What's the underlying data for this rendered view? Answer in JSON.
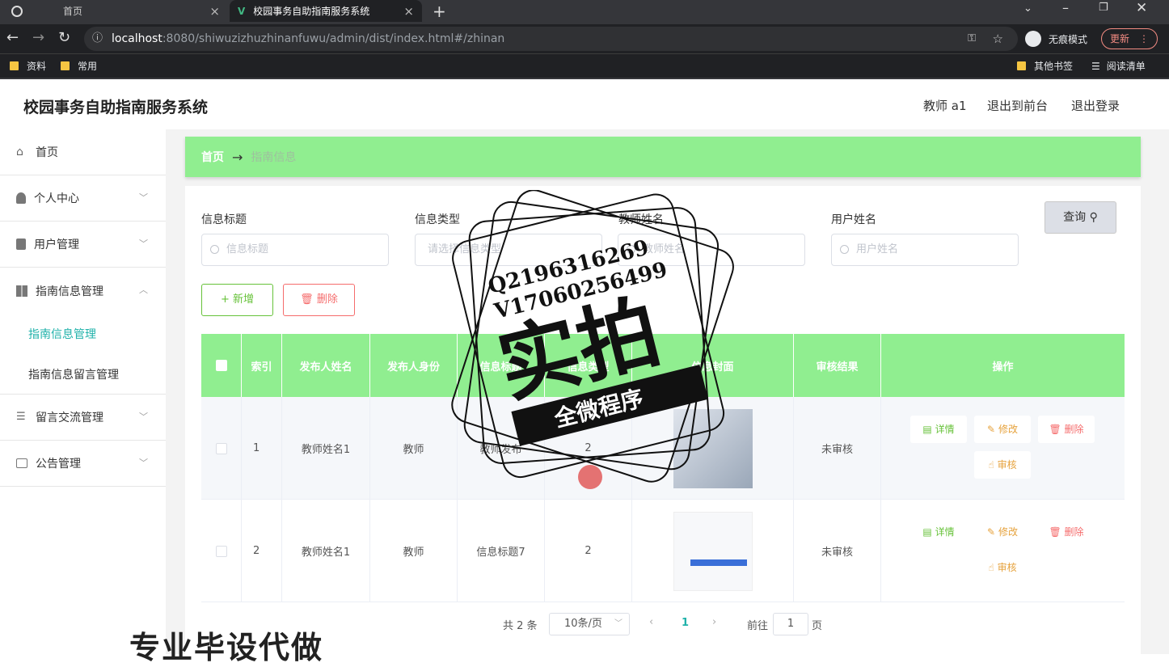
{
  "browser": {
    "tabs": [
      {
        "label": "首页"
      },
      {
        "label": "校园事务自助指南服务系统"
      }
    ],
    "url_host": "localhost",
    "url_rest": ":8080/shiwuzizhuzhinanfuwu/admin/dist/index.html#/zhinan",
    "incognito": "无痕模式",
    "update": "更新",
    "bookmarks": [
      "资料",
      "常用"
    ],
    "other_bookmarks": "其他书签",
    "reading_list": "阅读清单"
  },
  "header": {
    "title": "校园事务自助指南服务系统",
    "user": "教师 a1",
    "exit_front": "退出到前台",
    "logout": "退出登录"
  },
  "sidebar": {
    "items": [
      {
        "label": "首页"
      },
      {
        "label": "个人中心"
      },
      {
        "label": "用户管理"
      },
      {
        "label": "指南信息管理"
      },
      {
        "label": "留言交流管理"
      },
      {
        "label": "公告管理"
      }
    ],
    "subitems": [
      {
        "label": "指南信息管理"
      },
      {
        "label": "指南信息留言管理"
      }
    ]
  },
  "breadcrumb": {
    "home": "首页",
    "arrow": "→",
    "current": "指南信息"
  },
  "filters": {
    "f1": {
      "label": "信息标题",
      "placeholder": "信息标题"
    },
    "f2": {
      "label": "信息类型",
      "placeholder": "请选择信息类型"
    },
    "f3": {
      "label": "教师姓名",
      "placeholder": "教师姓名"
    },
    "f4": {
      "label": "用户姓名",
      "placeholder": "用户姓名"
    },
    "query": "查询"
  },
  "actions": {
    "add": "+ 新增",
    "delete": "删除"
  },
  "table": {
    "headers": [
      "索引",
      "发布人姓名",
      "发布人身份",
      "信息标题",
      "信息类型",
      "信息封面",
      "审核结果",
      "操作"
    ],
    "rows": [
      {
        "index": "1",
        "name": "教师姓名1",
        "role": "教师",
        "title": "教师发布",
        "type": "2",
        "status": "未审核"
      },
      {
        "index": "2",
        "name": "教师姓名1",
        "role": "教师",
        "title": "信息标题7",
        "type": "2",
        "status": "未审核"
      }
    ],
    "ops": {
      "detail": "详情",
      "edit": "修改",
      "delete": "删除",
      "audit": "审核"
    }
  },
  "pager": {
    "total": "共 2 条",
    "size": "10条/页",
    "page": "1",
    "goto": "前往",
    "goto_val": "1",
    "unit": "页"
  },
  "overlay": {
    "qq": "Q2196316269",
    "vx": "V17060256499",
    "big": "实拍",
    "banner": "全微程序",
    "footer": "专业毕设代做"
  }
}
